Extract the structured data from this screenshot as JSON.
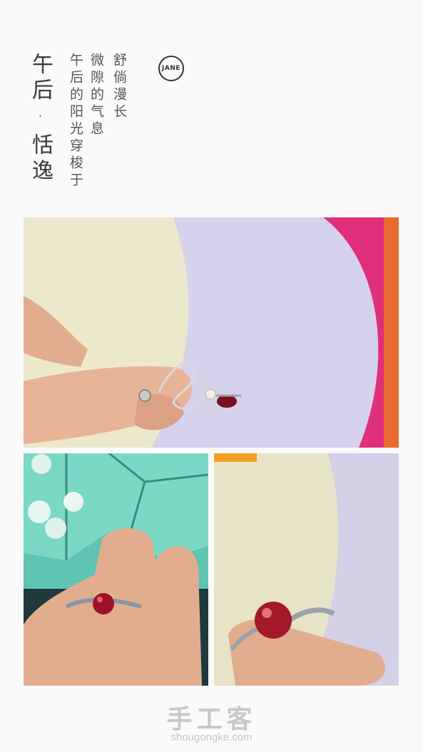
{
  "poster": {
    "title": "午后·恬逸",
    "column_1": "午后的阳光穿梭于",
    "column_2": "微隙的气息",
    "column_3": "舒倘漫长",
    "badge": "JANE"
  },
  "watermark": {
    "logo": "手工客",
    "url": "shougongke.com"
  },
  "colors": {
    "background": "#fafafa",
    "lavender_fabric": "#d6d2ec",
    "cream_paper": "#ece8cc",
    "magenta": "#e0307a",
    "bead_red": "#a3182a",
    "skin": "#e2ad8f",
    "bead_box_teal": "#7ad8c4"
  }
}
